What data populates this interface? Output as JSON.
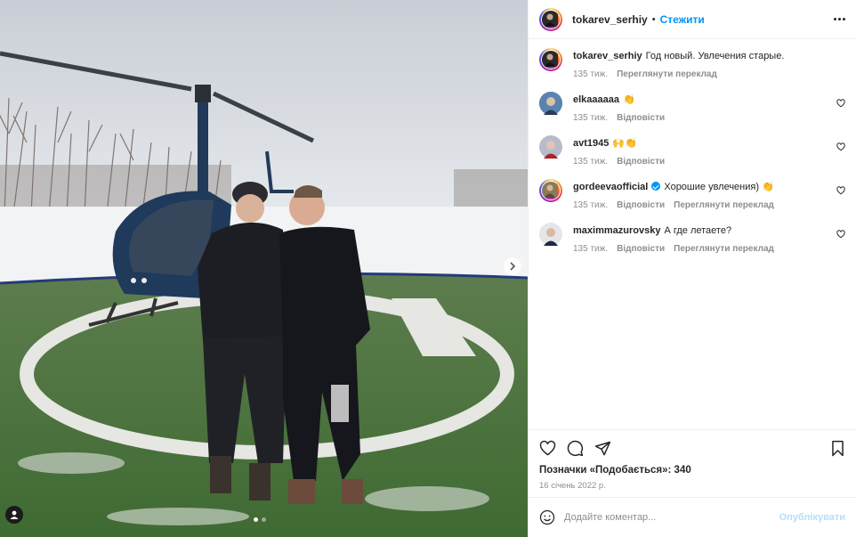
{
  "post": {
    "username": "tokarev_serhiy",
    "follow_label": "Стежити",
    "separator": "•",
    "caption": {
      "username": "tokarev_serhiy",
      "text": "Год новый. Увлечения старые.",
      "time": "135 тиж.",
      "action": "Переглянути переклад"
    },
    "comments": [
      {
        "username": "elkaaaaaa",
        "text": "👏",
        "time": "135 тиж.",
        "actions": [
          "Відповісти"
        ],
        "verified": false
      },
      {
        "username": "avt1945",
        "text": "🙌👏",
        "time": "135 тиж.",
        "actions": [
          "Відповісти"
        ],
        "verified": false
      },
      {
        "username": "gordeevaofficial",
        "text": "Хорошие увлечения) 👏",
        "time": "135 тиж.",
        "actions": [
          "Відповісти",
          "Переглянути переклад"
        ],
        "verified": true
      },
      {
        "username": "maximmazurovsky",
        "text": "А где летаете?",
        "time": "135 тиж.",
        "actions": [
          "Відповісти",
          "Переглянути переклад"
        ],
        "verified": false
      }
    ],
    "likes_text": "Позначки «Подобається»: 340",
    "date": "16 січень 2022 р.",
    "add_comment_placeholder": "Додайте коментар...",
    "publish_label": "Опублікувати"
  },
  "colors": {
    "accent": "#0095f6",
    "publish_disabled": "#b2dffc",
    "secondary_text": "#8e8e8e",
    "border": "#efefef"
  },
  "icons": {
    "more": "more-options-icon",
    "heart": "heart-icon",
    "comment": "comment-icon",
    "share": "share-icon",
    "save": "bookmark-icon",
    "emoji": "emoji-icon",
    "next": "chevron-right-icon",
    "tag": "user-tag-icon"
  },
  "carousel": {
    "count": 2,
    "active": 1
  }
}
